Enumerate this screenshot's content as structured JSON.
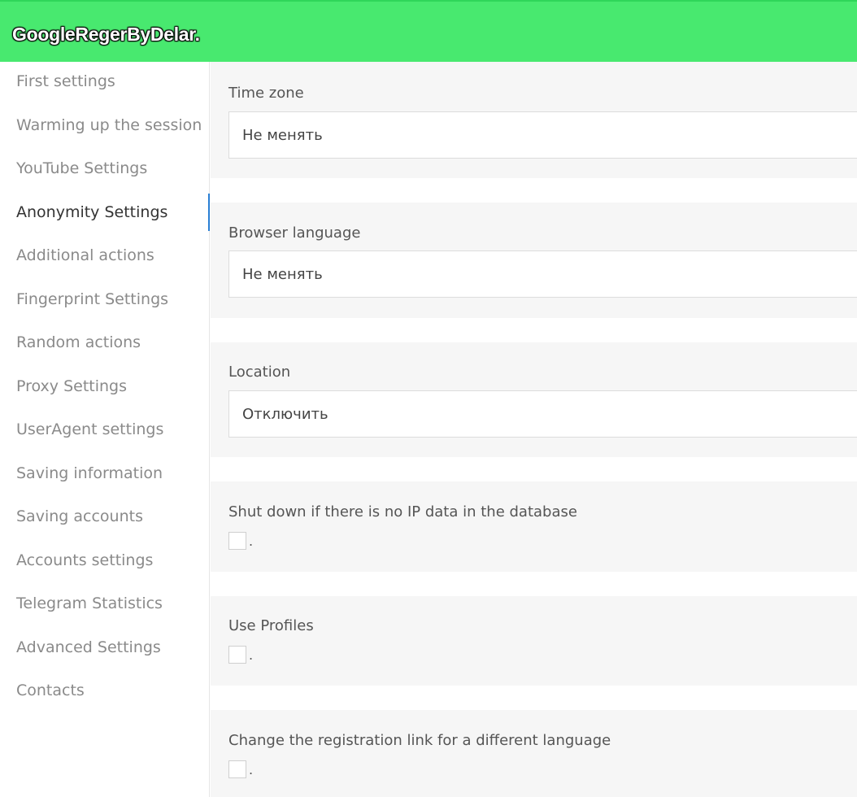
{
  "app": {
    "title": "GoogleRegerByDelar."
  },
  "colors": {
    "header_bg": "#48e96f",
    "active_indicator": "#2a7fd4",
    "panel_bg": "#f6f6f6"
  },
  "sidebar": {
    "items": [
      {
        "label": "First settings"
      },
      {
        "label": "Warming up the session"
      },
      {
        "label": "YouTube Settings"
      },
      {
        "label": "Anonymity Settings"
      },
      {
        "label": "Additional actions"
      },
      {
        "label": "Fingerprint Settings"
      },
      {
        "label": "Random actions"
      },
      {
        "label": "Proxy Settings"
      },
      {
        "label": "UserAgent settings"
      },
      {
        "label": "Saving information"
      },
      {
        "label": "Saving accounts"
      },
      {
        "label": "Accounts settings"
      },
      {
        "label": "Telegram Statistics"
      },
      {
        "label": "Advanced Settings"
      },
      {
        "label": "Contacts"
      }
    ],
    "active": "Anonymity Settings"
  },
  "form": {
    "time_zone": {
      "label": "Time zone",
      "value": "Не менять"
    },
    "browser_language": {
      "label": "Browser language",
      "value": "Не менять"
    },
    "location": {
      "label": "Location",
      "value": "Отключить"
    },
    "shutdown_no_ip": {
      "label": "Shut down if there is no IP data in the database",
      "suffix": ".",
      "checked": false
    },
    "use_profiles": {
      "label": "Use Profiles",
      "suffix": ".",
      "checked": false
    },
    "change_reg_link": {
      "label": "Change the registration link for a different language",
      "suffix": ".",
      "checked": false
    }
  }
}
